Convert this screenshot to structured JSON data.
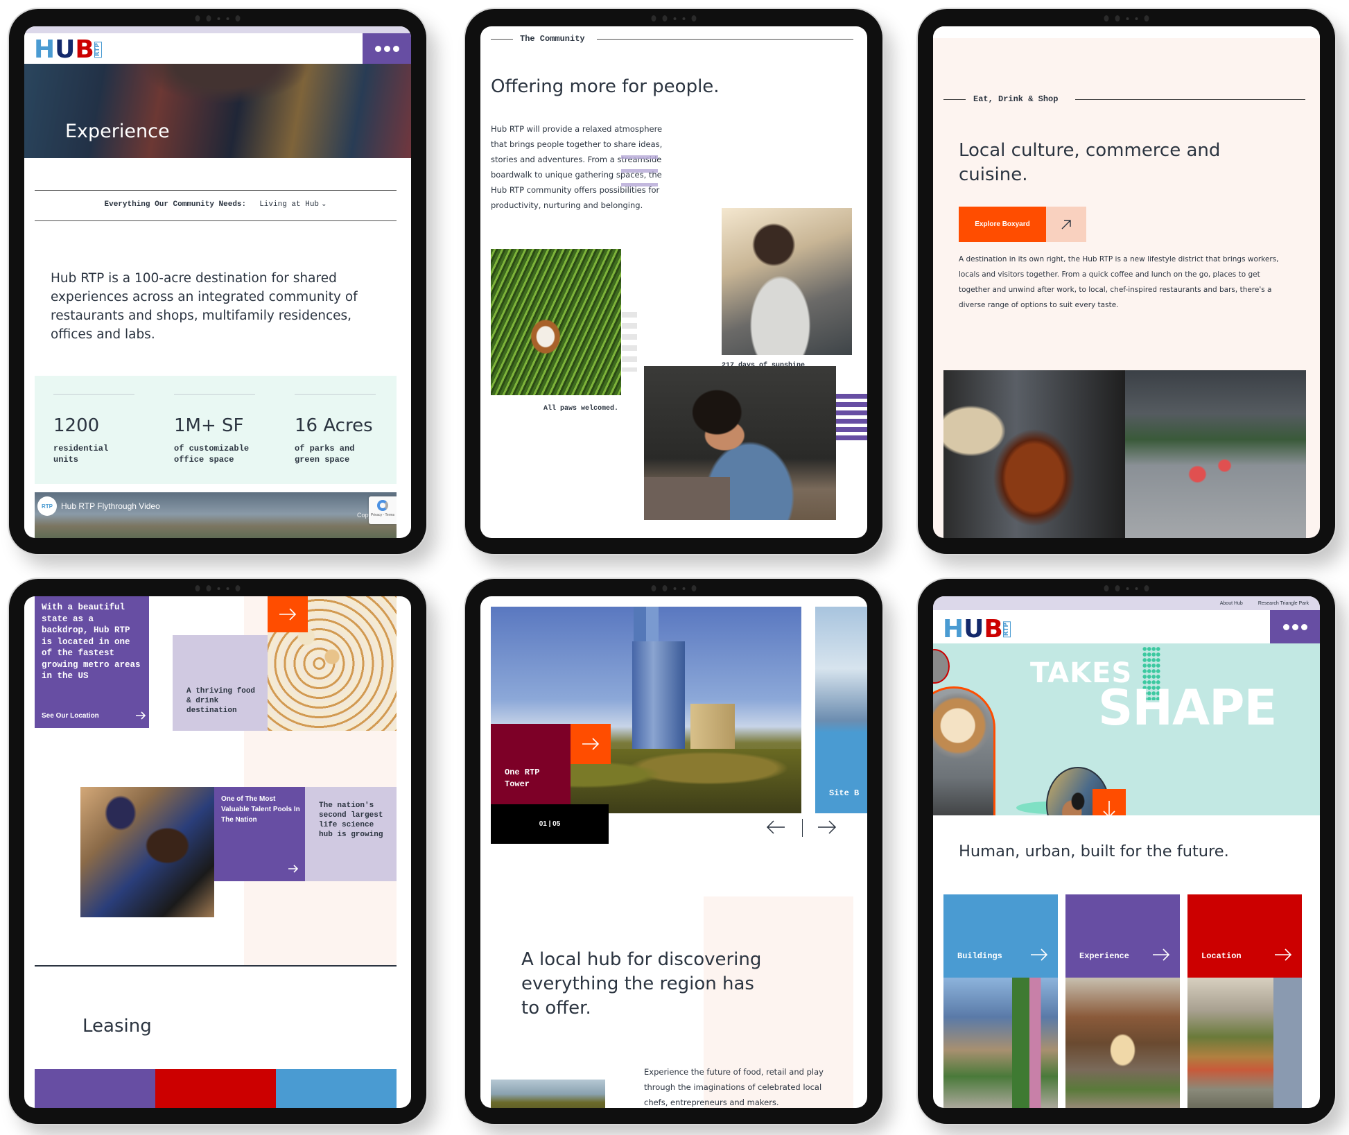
{
  "colors": {
    "purple": "#674ea3",
    "red": "#cc0000",
    "blue": "#4a9bd2",
    "orange": "#ff4d00",
    "maroon": "#7d0027",
    "peach": "#fdf4f0",
    "mint": "#e9f8f3",
    "lilac": "#d0c9e1",
    "teal": "#c2e8e3",
    "navy": "#13296b",
    "text": "#2b3440"
  },
  "logo": {
    "letters": [
      "H",
      "U",
      "B"
    ],
    "badge": "RTP"
  },
  "screen1": {
    "hero_title": "Experience",
    "filter_label": "Everything Our Community Needs:",
    "filter_value": "Living at Hub",
    "intro": "Hub RTP is a 100-acre destination for shared experiences across an integrated community of restaurants and shops, multifamily residences, offices and labs.",
    "stats": [
      {
        "value": "1200",
        "label": "residential units"
      },
      {
        "value": "1M+ SF",
        "label": "of customizable office space"
      },
      {
        "value": "16 Acres",
        "label": "of parks and green space"
      }
    ],
    "video": {
      "badge": "RTP",
      "title": "Hub RTP Flythrough Video",
      "copy_label": "Copy",
      "recaptcha": "Privacy - Terms"
    }
  },
  "screen2": {
    "eyebrow": "The Community",
    "heading": "Offering more for people.",
    "body": "Hub RTP will provide a relaxed atmosphere that brings people together to share ideas, stories and adventures. From a streamside boardwalk to unique gathering spaces, the Hub RTP community offers possibilities for productivity, nurturing and belonging.",
    "dog_caption": "All paws welcomed.",
    "sun_caption": "217 days of sunshine"
  },
  "screen3": {
    "eyebrow": "Eat, Drink & Shop",
    "heading": "Local culture, commerce and cuisine.",
    "cta_label": "Explore Boxyard",
    "body": "A destination in its own right, the Hub RTP is a new lifestyle district that brings workers, locals and visitors together. From a quick coffee and lunch on the go, places to get together and unwind after work, to local, chef-inspired restaurants and bars, there's a diverse range of options to suit every taste."
  },
  "screen4": {
    "location_card": "With a beautiful state as a backdrop, Hub RTP is located in one of the fastest growing metro areas in the US",
    "location_link": "See Our Location",
    "food_card": "A thriving food & drink destination",
    "talent_card": "One of The Most Valuable Talent Pools In The Nation",
    "science_card": "The nation's second largest life science hub is growing",
    "leasing_heading": "Leasing"
  },
  "screen5": {
    "slide_title": "One RTP Tower",
    "next_slide_title": "Site B",
    "counter": "01 | 05",
    "heading": "A local hub for discovering everything the region has to offer.",
    "body": "Experience the future of food, retail and play through the imaginations of celebrated local chefs, entrepreneurs and makers. Welcoming, dynamic and"
  },
  "screen6": {
    "top_links": [
      "About Hub",
      "Research Triangle Park"
    ],
    "hero_word1": "TAKES",
    "hero_word2": "SHAPE",
    "heading": "Human, urban, built for the future.",
    "cards": [
      {
        "label": "Buildings",
        "color": "#4a9bd2"
      },
      {
        "label": "Experience",
        "color": "#674ea3"
      },
      {
        "label": "Location",
        "color": "#cc0000"
      }
    ]
  }
}
